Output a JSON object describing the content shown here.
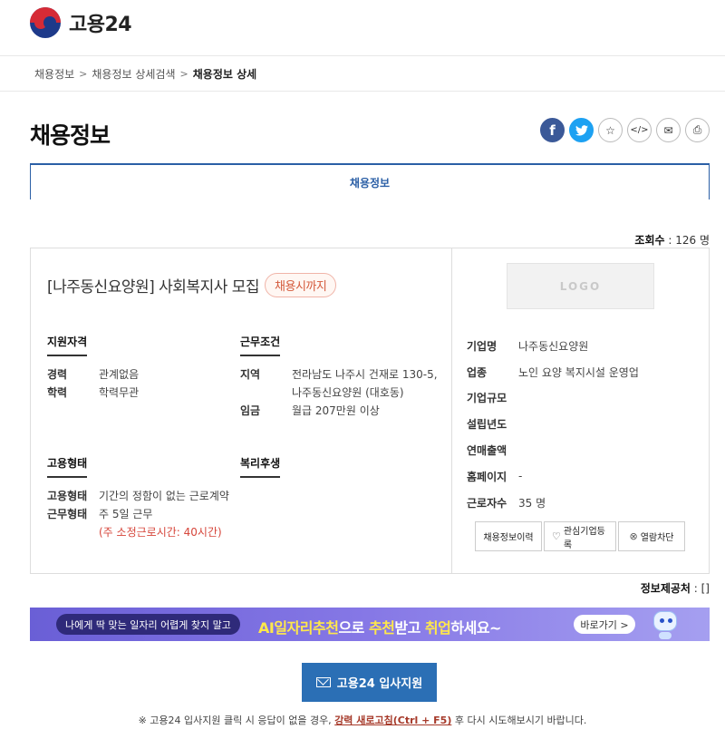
{
  "header": {
    "logo_text": "고용24"
  },
  "breadcrumb": {
    "item1": "채용정보",
    "item2": "채용정보 상세검색",
    "current": "채용정보 상세",
    "sep": ">"
  },
  "page_title": "채용정보",
  "share": {
    "facebook": "f",
    "twitter": "t",
    "star": "☆",
    "embed": "</>",
    "mail": "✉",
    "print": "⎙"
  },
  "tab": {
    "label": "채용정보"
  },
  "views": {
    "label": "조회수",
    "value": ": 126 명"
  },
  "job": {
    "title": "[나주동신요양원] 사회복지사 모집",
    "badge": "채용시까지",
    "qualification": {
      "heading": "지원자격",
      "career_label": "경력",
      "career_value": "관계없음",
      "edu_label": "학력",
      "edu_value": "학력무관"
    },
    "conditions": {
      "heading": "근무조건",
      "region_label": "지역",
      "region_value_1": "전라남도 나주시 건재로 130-5,",
      "region_value_2": "나주동신요양원 (대호동)",
      "wage_label": "임금",
      "wage_value": "월급 207만원 이상"
    },
    "employment": {
      "heading": "고용형태",
      "type_label": "고용형태",
      "type_value": "기간의 정함이 없는 근로계약",
      "work_label": "근무형태",
      "work_value": "주 5일 근무",
      "note": "(주 소정근로시간: 40시간)"
    },
    "welfare": {
      "heading": "복리후생"
    }
  },
  "company": {
    "logo_placeholder": "LOGO",
    "rows": [
      {
        "label": "기업명",
        "value": "나주동신요양원"
      },
      {
        "label": "업종",
        "value": "노인 요양 복지시설 운영업"
      },
      {
        "label": "기업규모",
        "value": ""
      },
      {
        "label": "설립년도",
        "value": ""
      },
      {
        "label": "연매출액",
        "value": ""
      },
      {
        "label": "홈페이지",
        "value": "-"
      },
      {
        "label": "근로자수",
        "value": "35 명"
      }
    ],
    "actions": {
      "history": "채용정보이력",
      "interest": "관심기업등록",
      "block": "열람차단"
    }
  },
  "provider": {
    "label": "정보제공처",
    "value": ": []"
  },
  "banner": {
    "pill": "나에게 딱 맞는 일자리 어렵게 찾지 말고",
    "main_ai": "AI일자리추천",
    "main_mid": "으로 ",
    "main_rec": "추천",
    "main_end": "받고 ",
    "main_job": "취업",
    "main_tail": "하세요~",
    "go": "바로가기 >"
  },
  "apply_button": "고용24 입사지원",
  "footer": {
    "prefix": "※ 고용24 입사지원 클릭 시 응답이 없을 경우, ",
    "link": "강력 새로고침(Ctrl + F5)",
    "suffix": " 후 다시 시도해보시기 바랍니다."
  }
}
